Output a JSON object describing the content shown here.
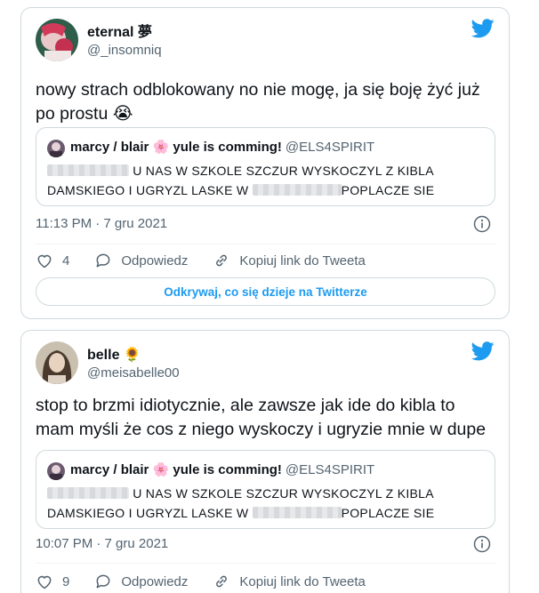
{
  "tweets": [
    {
      "display_name": "eternal 夢",
      "handle": "@_insomniq",
      "text_line1": "nowy strach odblokowany no nie mogę, ja się boję żyć już",
      "text_line2": "po prostu 😭",
      "quote": {
        "display_name": "marcy / blair 🌸 yule is comming!",
        "handle": "@ELS4SPIRIT",
        "line1_visible": "U NAS W SZKOLE SZCZUR WYSKOCZYL Z KIBLA",
        "line2_start": "DAMSKIEGO I UGRYZL LASKE W",
        "line2_end": "POPLACZE SIE"
      },
      "timestamp": "11:13 PM · 7 gru 2021",
      "likes": "4",
      "reply_label": "Odpowiedz",
      "copy_label": "Kopiuj link do Tweeta",
      "discover_label": "Odkrywaj, co się dzieje na Twitterze"
    },
    {
      "display_name": "belle 🌻",
      "handle": "@meisabelle00",
      "text_line1": "stop to brzmi idiotycznie, ale zawsze jak ide do kibla to",
      "text_line2": "mam myśli że cos z niego wyskoczy i ugryzie mnie w dupe",
      "quote": {
        "display_name": "marcy / blair 🌸 yule is comming!",
        "handle": "@ELS4SPIRIT",
        "line1_visible": "U NAS W SZKOLE SZCZUR WYSKOCZYL Z KIBLA",
        "line2_start": "DAMSKIEGO I UGRYZL LASKE W",
        "line2_end": "POPLACZE SIE"
      },
      "timestamp": "10:07 PM · 7 gru 2021",
      "likes": "9",
      "reply_label": "Odpowiedz",
      "copy_label": "Kopiuj link do Tweeta"
    }
  ],
  "colors": {
    "twitter_blue": "#1d9bf0",
    "text_primary": "#0f1419",
    "text_secondary": "#536471",
    "border": "#cfd9de"
  },
  "icons": [
    "twitter-bird-icon",
    "info-icon",
    "heart-icon",
    "reply-icon",
    "link-icon"
  ]
}
